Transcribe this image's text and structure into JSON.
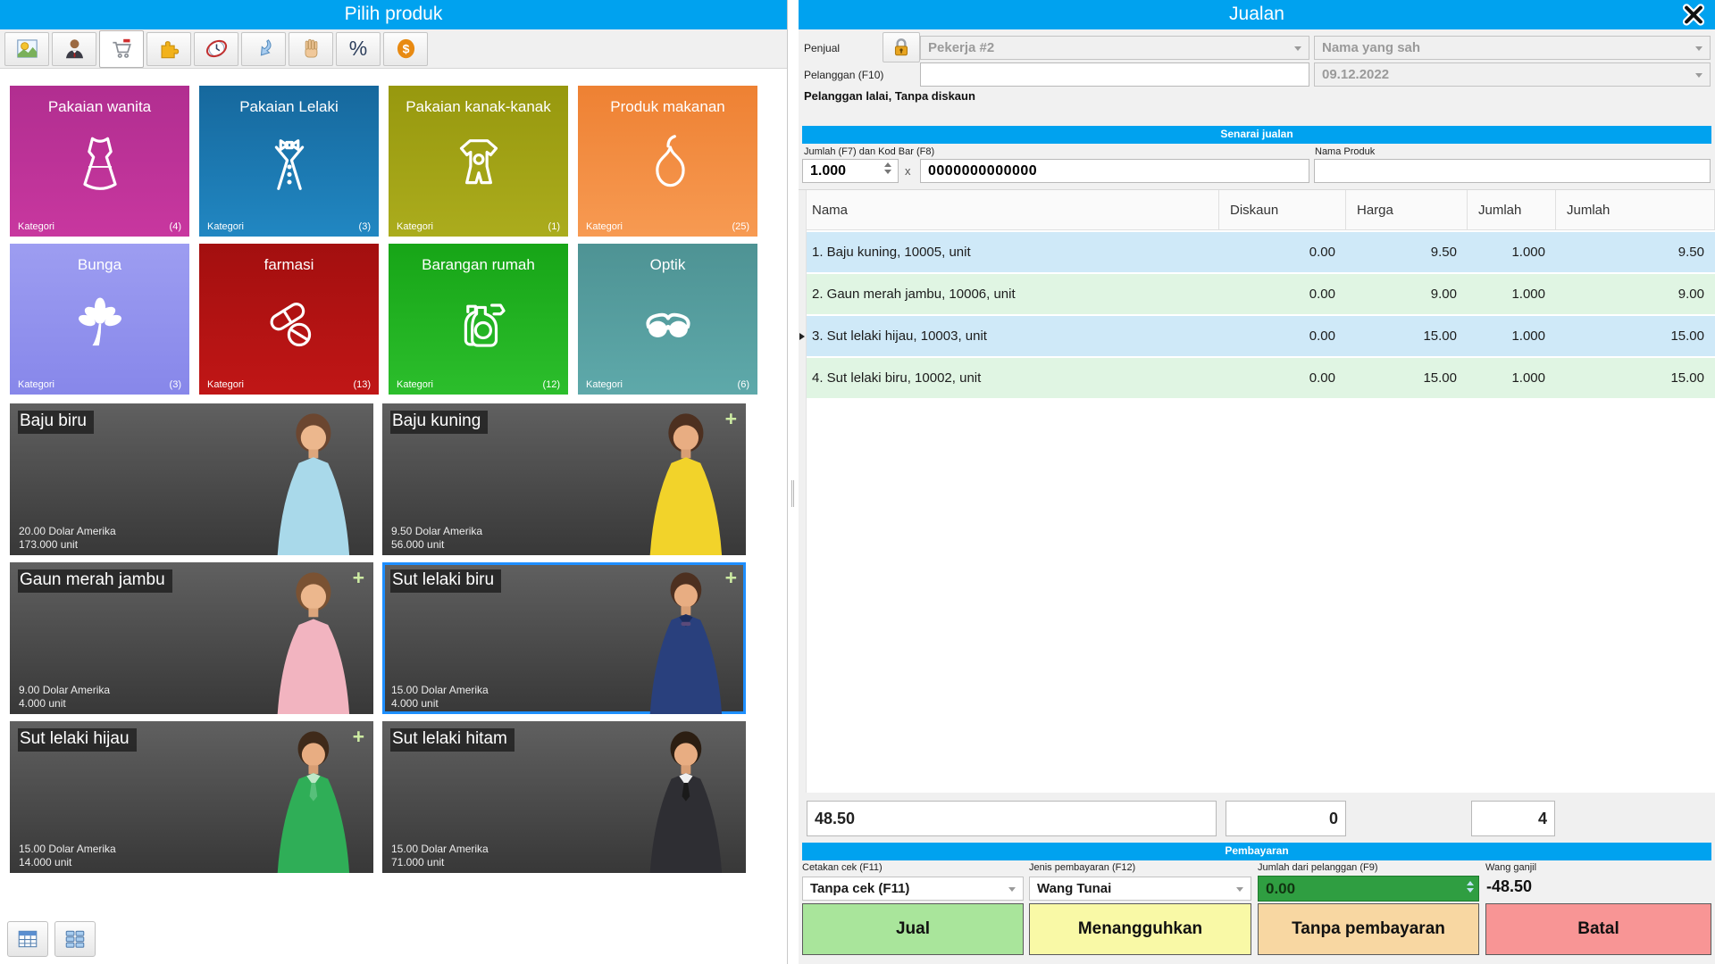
{
  "colors": {
    "titlebar_blue": "#00a2ef",
    "row_blue": "#cfe9f8",
    "row_green": "#e0f5e3",
    "customer_amount_green": "#2f9e41",
    "selected_tile_border": "#1e8fff"
  },
  "left_panel": {
    "title": "Pilih produk",
    "kategori_label": "Kategori",
    "plus_glyph": "+",
    "toolbar": [
      {
        "icon": "picture-icon"
      },
      {
        "icon": "person-icon"
      },
      {
        "icon": "cart-icon"
      },
      {
        "icon": "puzzle-icon"
      },
      {
        "icon": "clock-icon"
      },
      {
        "icon": "undo-arrow-icon"
      },
      {
        "icon": "hand-icon"
      },
      {
        "icon": "percent-icon",
        "glyph": "%"
      },
      {
        "icon": "dollar-icon",
        "glyph": "$"
      }
    ],
    "categories": [
      {
        "name": "Pakaian wanita",
        "count": "(4)",
        "color1": "#b12e90",
        "color2": "#c8379f",
        "icon": "dress-icon"
      },
      {
        "name": "Pakaian Lelaki",
        "count": "(3)",
        "color1": "#16689d",
        "color2": "#2187c2",
        "icon": "tuxedo-icon"
      },
      {
        "name": "Pakaian kanak-kanak",
        "count": "(1)",
        "color1": "#97980e",
        "color2": "#abac1d",
        "icon": "onesie-icon"
      },
      {
        "name": "Produk makanan",
        "count": "(25)",
        "color1": "#ee8133",
        "color2": "#f79a52",
        "icon": "pear-icon"
      },
      {
        "name": "Bunga",
        "count": "(3)",
        "color1": "#9d9df1",
        "color2": "#8787ea",
        "icon": "flower-icon"
      },
      {
        "name": "farmasi",
        "count": "(13)",
        "color1": "#a30f0f",
        "color2": "#c01616",
        "icon": "pills-icon"
      },
      {
        "name": "Barangan rumah",
        "count": "(12)",
        "color1": "#17a517",
        "color2": "#2cbe2c",
        "icon": "household-icon"
      },
      {
        "name": "Optik",
        "count": "(6)",
        "color1": "#4e9394",
        "color2": "#5ea9aa",
        "icon": "glasses-icon"
      }
    ],
    "products": [
      {
        "name": "Baju biru",
        "price": "20.00 Dolar Amerika",
        "stock": "173.000 unit",
        "in_cart": false,
        "selected": false,
        "clothing_color": "#a9d9ea"
      },
      {
        "name": "Baju kuning",
        "price": "9.50 Dolar Amerika",
        "stock": "56.000 unit",
        "in_cart": true,
        "selected": false,
        "clothing_color": "#f2d32a"
      },
      {
        "name": "Gaun merah jambu",
        "price": "9.00 Dolar Amerika",
        "stock": "4.000 unit",
        "in_cart": true,
        "selected": false,
        "clothing_color": "#f2b4c0"
      },
      {
        "name": "Sut lelaki biru",
        "price": "15.00 Dolar Amerika",
        "stock": "4.000 unit",
        "in_cart": true,
        "selected": true,
        "clothing_color": "#29407d"
      },
      {
        "name": "Sut lelaki hijau",
        "price": "15.00 Dolar Amerika",
        "stock": "14.000 unit",
        "in_cart": true,
        "selected": false,
        "clothing_color": "#2fae57"
      },
      {
        "name": "Sut lelaki hitam",
        "price": "15.00 Dolar Amerika",
        "stock": "71.000 unit",
        "in_cart": false,
        "selected": false,
        "clothing_color": "#2e2e33"
      }
    ],
    "view_buttons": [
      {
        "icon": "table-view-icon"
      },
      {
        "icon": "grid-view-icon"
      }
    ]
  },
  "right_panel": {
    "title": "Jualan",
    "close_icon": "close-x-icon",
    "form": {
      "penjual_label": "Penjual",
      "penjual_value": "Pekerja #2",
      "nama_value": "Nama yang sah",
      "pelanggan_label": "Pelanggan (F10)",
      "pelanggan_value": "",
      "date_value": "09.12.2022",
      "note": "Pelanggan lalai, Tanpa diskaun",
      "lock_icon": "lock-icon"
    },
    "sales": {
      "header": "Senarai jualan",
      "qty_barcode_label": "Jumlah (F7) dan Kod Bar (F8)",
      "qty_value": "1.000",
      "times_glyph": "x",
      "barcode_value": "0000000000000",
      "product_name_label": "Nama Produk",
      "columns": [
        "Nama",
        "Diskaun",
        "Harga",
        "Jumlah",
        "Jumlah"
      ],
      "rows": [
        {
          "name": "1. Baju kuning, 10005, unit",
          "diskaun": "0.00",
          "harga": "9.50",
          "jumlah": "1.000",
          "total": "9.50"
        },
        {
          "name": "2. Gaun merah jambu, 10006, unit",
          "diskaun": "0.00",
          "harga": "9.00",
          "jumlah": "1.000",
          "total": "9.00"
        },
        {
          "name": "3. Sut lelaki hijau, 10003, unit",
          "diskaun": "0.00",
          "harga": "15.00",
          "jumlah": "1.000",
          "total": "15.00"
        },
        {
          "name": "4. Sut lelaki biru, 10002, unit",
          "diskaun": "0.00",
          "harga": "15.00",
          "jumlah": "1.000",
          "total": "15.00"
        }
      ],
      "totals": {
        "sum": "48.50",
        "discount": "0",
        "quantity": "4"
      }
    },
    "payment": {
      "header": "Pembayaran",
      "cetakan_label": "Cetakan cek (F11)",
      "cetakan_value": "Tanpa cek (F11)",
      "jenis_label": "Jenis pembayaran (F12)",
      "jenis_value": "Wang Tunai",
      "jumlah_label": "Jumlah dari pelanggan (F9)",
      "jumlah_value": "0.00",
      "wang_label": "Wang ganjil",
      "wang_value": "-48.50",
      "buttons": [
        {
          "label": "Jual",
          "bg": "#a9e59b"
        },
        {
          "label": "Menangguhkan",
          "bg": "#f9f9a6"
        },
        {
          "label": "Tanpa pembayaran",
          "bg": "#f8d7a2"
        },
        {
          "label": "Batal",
          "bg": "#f89595"
        }
      ]
    }
  }
}
